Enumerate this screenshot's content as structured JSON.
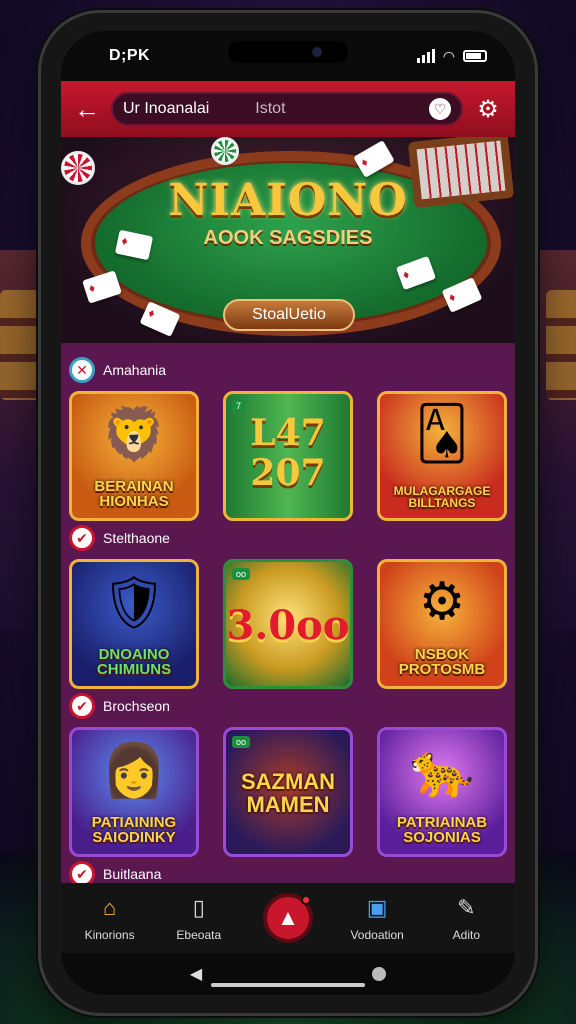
{
  "status_bar": {
    "time": "D;PK"
  },
  "topbar": {
    "search_value": "Ur Inoanalai",
    "search_placeholder": "Istot"
  },
  "hero": {
    "title": "NIAIONO",
    "subtitle": "AOOK SAGSDIES",
    "cta_label": "StoalUetio"
  },
  "sections": [
    {
      "title": "Amahania",
      "games": [
        {
          "name": "BERAINAN HIONHAS",
          "icon": "lion-icon"
        },
        {
          "name": "L A 7 2 0 7",
          "big": "L47\n207"
        },
        {
          "name": "MULAGARGAGE BILLTANGS",
          "icon": "woman-cards-icon"
        }
      ]
    },
    {
      "title": "Stelthaone",
      "games": [
        {
          "name": "DNOAINO CHIMIUNS",
          "icon": "woman-shield-icon"
        },
        {
          "name": "3.0oo",
          "big": "3.0oo"
        },
        {
          "name": "NSBOK PROTOSMB",
          "icon": "cannon-icon"
        }
      ]
    },
    {
      "title": "Brochseon",
      "games": [
        {
          "name": "PATIAINING SAIODINKY",
          "icon": "woman-icon"
        },
        {
          "name": "SAZMAN MAMEN",
          "icon": "emblem-icon"
        },
        {
          "name": "PATRIAINAB SOJONIAS",
          "icon": "lion-icon"
        }
      ]
    },
    {
      "title": "Buitlaana"
    }
  ],
  "navbar": {
    "items": [
      "Kinorions",
      "Ebeoata",
      "",
      "Vodoation",
      "Adito"
    ]
  },
  "colors": {
    "brand_red": "#c8172c",
    "gold": "#f7c83b",
    "content_bg": "#5b1750"
  }
}
